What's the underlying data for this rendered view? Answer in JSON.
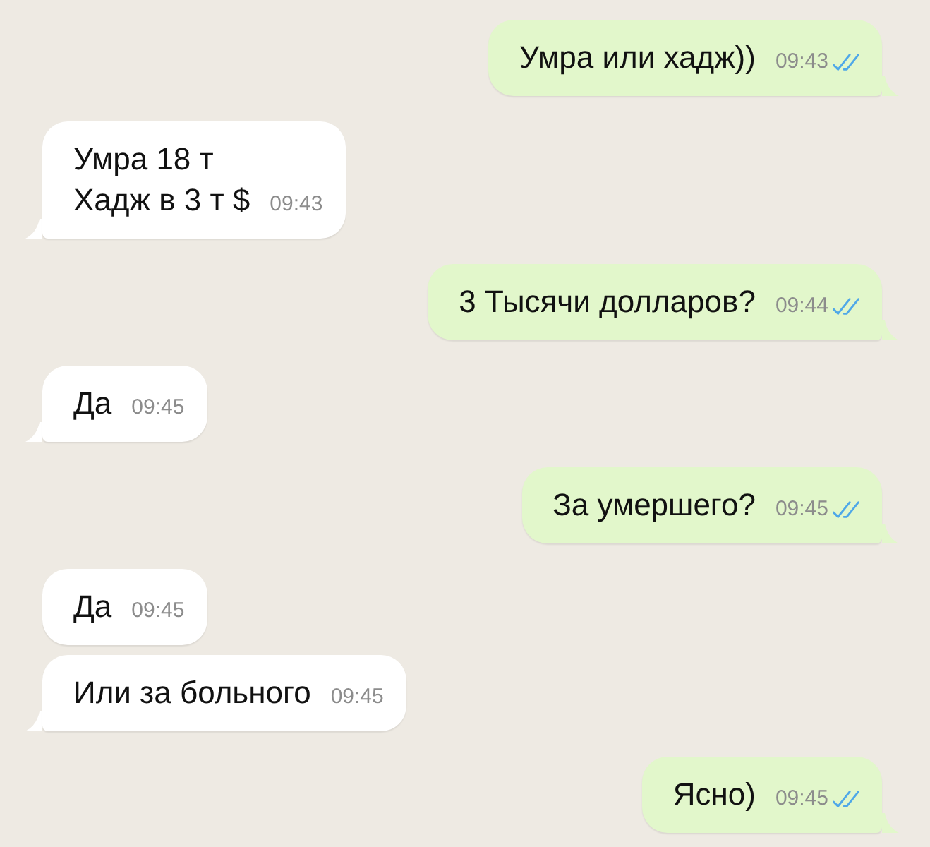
{
  "messages": [
    {
      "kind": "outgoing",
      "text": "Умра или хадж))",
      "time": "09:43",
      "read": true
    },
    {
      "kind": "incoming",
      "text": "Умра 18 т\nХадж в 3 т $",
      "time": "09:43"
    },
    {
      "kind": "outgoing",
      "text": "3 Тысячи долларов?",
      "time": "09:44",
      "read": true
    },
    {
      "kind": "incoming",
      "text": "Да",
      "time": "09:45"
    },
    {
      "kind": "outgoing",
      "text": "За умершего?",
      "time": "09:45",
      "read": true
    },
    {
      "kind": "incoming",
      "text": "Да",
      "time": "09:45"
    },
    {
      "kind": "incoming",
      "text": "Или за больного",
      "time": "09:45"
    },
    {
      "kind": "outgoing",
      "text": "Ясно)",
      "time": "09:45",
      "read": true
    }
  ]
}
